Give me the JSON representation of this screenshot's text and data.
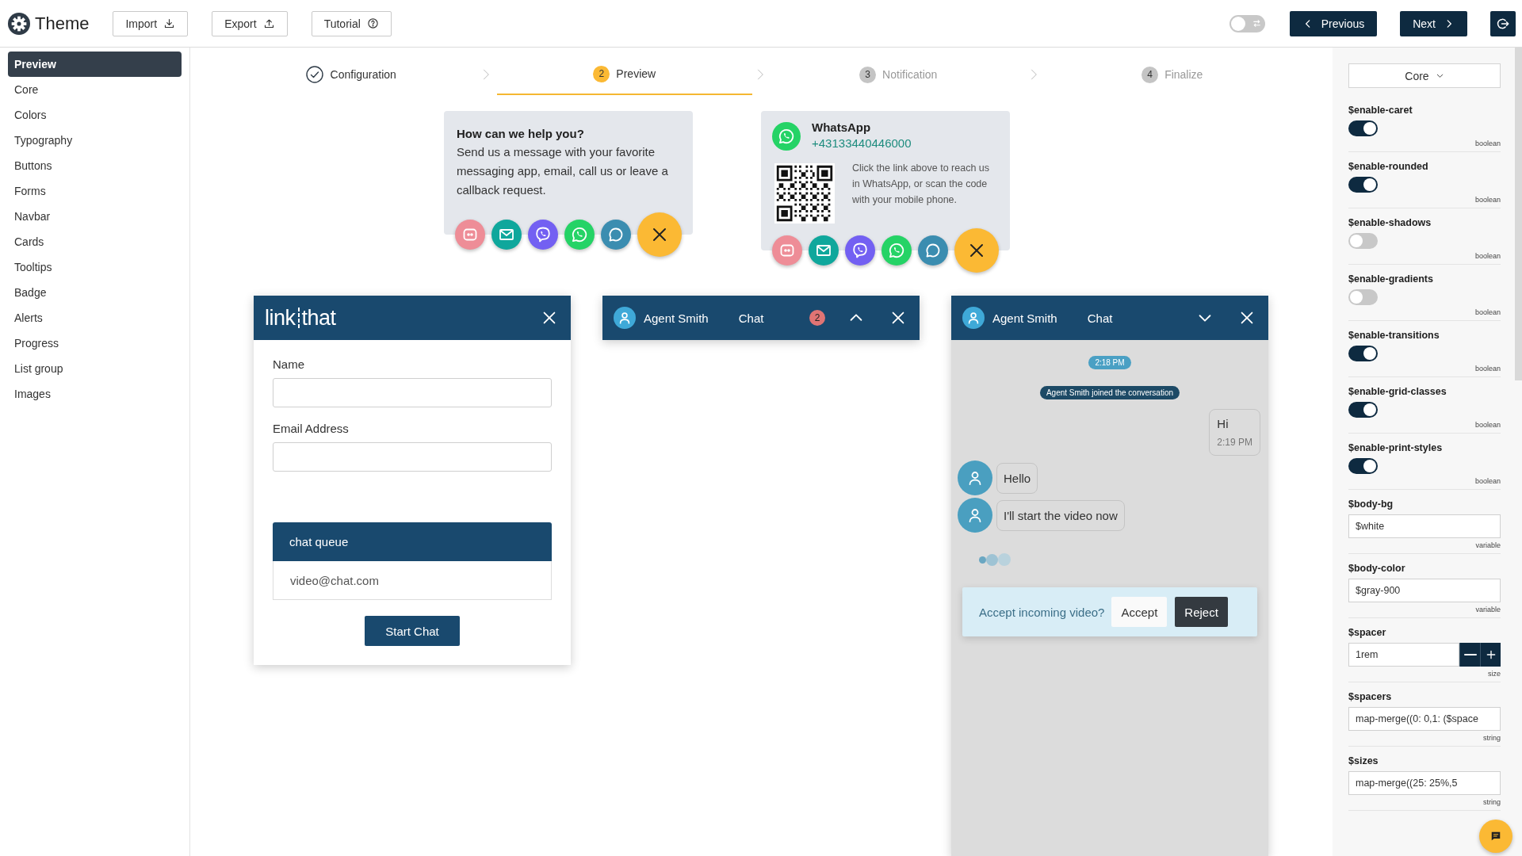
{
  "header": {
    "title": "Theme",
    "buttons": [
      {
        "label": "Import",
        "kind": "import"
      },
      {
        "label": "Export",
        "kind": "export"
      },
      {
        "label": "Tutorial",
        "kind": "help"
      }
    ],
    "toggle": {
      "on": false
    },
    "nav": [
      {
        "label": "Previous",
        "kind": "prev"
      },
      {
        "label": "Next",
        "kind": "next"
      }
    ]
  },
  "sidebar": {
    "items": [
      {
        "label": "Preview",
        "selected": true
      },
      {
        "label": "Core",
        "selected": false
      },
      {
        "label": "Colors",
        "selected": false
      },
      {
        "label": "Typography",
        "selected": false
      },
      {
        "label": "Buttons",
        "selected": false
      },
      {
        "label": "Forms",
        "selected": false
      },
      {
        "label": "Navbar",
        "selected": false
      },
      {
        "label": "Cards",
        "selected": false
      },
      {
        "label": "Tooltips",
        "selected": false
      },
      {
        "label": "Badge",
        "selected": false
      },
      {
        "label": "Alerts",
        "selected": false
      },
      {
        "label": "Progress",
        "selected": false
      },
      {
        "label": "List group",
        "selected": false
      },
      {
        "label": "Images",
        "selected": false
      }
    ]
  },
  "stepper": {
    "steps": [
      {
        "label": "Configuration",
        "completed": true,
        "selected": false
      },
      {
        "number": "2",
        "label": "Preview",
        "completed": false,
        "selected": true
      },
      {
        "number": "3",
        "label": "Notification",
        "completed": false,
        "selected": false
      },
      {
        "number": "4",
        "label": "Finalize",
        "completed": false,
        "selected": false
      }
    ]
  },
  "widgets": [
    {
      "kind": "intro",
      "title": "How can we help you?",
      "text": "Send us a message with your favorite messaging app, email, call us or leave a callback request.",
      "channels": [
        {
          "kind": "sms",
          "color": "#ee8d97"
        },
        {
          "kind": "email",
          "color": "#0fa79c"
        },
        {
          "kind": "viber",
          "color": "#7360f2"
        },
        {
          "kind": "whatsapp",
          "color": "#25d366"
        },
        {
          "kind": "chat",
          "color": "#3b8db0"
        },
        {
          "kind": "close",
          "color": "#fbb934"
        }
      ]
    },
    {
      "kind": "whatsapp",
      "title": "WhatsApp",
      "phone": "+43133440446000",
      "text": "Click the link above to reach us in WhatsApp, or scan the code with your mobile phone.",
      "channels": [
        {
          "kind": "sms",
          "color": "#ee8d97"
        },
        {
          "kind": "email",
          "color": "#0fa79c"
        },
        {
          "kind": "viber",
          "color": "#7360f2"
        },
        {
          "kind": "whatsapp",
          "color": "#25d366"
        },
        {
          "kind": "chat",
          "color": "#3b8db0"
        },
        {
          "kind": "close",
          "color": "#fbb934"
        }
      ]
    }
  ],
  "chat_windows": [
    {
      "kind": "form",
      "logo": [
        "link",
        "that"
      ],
      "fields": [
        {
          "label": "Name"
        },
        {
          "label": "Email Address"
        }
      ],
      "queue": {
        "title": "chat queue",
        "address": "video@chat.com"
      },
      "button": "Start Chat"
    },
    {
      "kind": "minimized",
      "agent": "Agent Smith",
      "title": "Chat",
      "badge": "2",
      "expanded": false
    },
    {
      "kind": "conversation",
      "agent": "Agent Smith",
      "title": "Chat",
      "expanded": true,
      "messages": [
        {
          "kind": "time",
          "text": "2:18 PM"
        },
        {
          "kind": "event",
          "text": "Agent Smith joined the conversation"
        },
        {
          "kind": "sent",
          "text": "Hi",
          "time": "2:19 PM"
        },
        {
          "kind": "received",
          "text": "Hello"
        },
        {
          "kind": "received",
          "text": "I'll start the video now"
        },
        {
          "kind": "typing"
        }
      ],
      "prompt": {
        "text": "Accept incoming video?",
        "accept": "Accept",
        "reject": "Reject"
      }
    }
  ],
  "settings_panel": {
    "section": "Core",
    "settings": [
      {
        "name": "$enable-caret",
        "kind": "toggle",
        "on": true,
        "type": "boolean"
      },
      {
        "name": "$enable-rounded",
        "kind": "toggle",
        "on": true,
        "type": "boolean"
      },
      {
        "name": "$enable-shadows",
        "kind": "toggle",
        "on": false,
        "type": "boolean"
      },
      {
        "name": "$enable-gradients",
        "kind": "toggle",
        "on": false,
        "type": "boolean"
      },
      {
        "name": "$enable-transitions",
        "kind": "toggle",
        "on": true,
        "type": "boolean"
      },
      {
        "name": "$enable-grid-classes",
        "kind": "toggle",
        "on": true,
        "type": "boolean"
      },
      {
        "name": "$enable-print-styles",
        "kind": "toggle",
        "on": true,
        "type": "boolean"
      },
      {
        "name": "$body-bg",
        "kind": "text",
        "value": "$white",
        "type": "variable"
      },
      {
        "name": "$body-color",
        "kind": "text",
        "value": "$gray-900",
        "type": "variable"
      },
      {
        "name": "$spacer",
        "kind": "stepper",
        "value": "1rem",
        "type": "size"
      },
      {
        "name": "$spacers",
        "kind": "text",
        "value": "map-merge((0: 0,1: ($space",
        "type": "string"
      },
      {
        "name": "$sizes",
        "kind": "text",
        "value": "map-merge((25: 25%,5",
        "type": "string"
      }
    ]
  }
}
